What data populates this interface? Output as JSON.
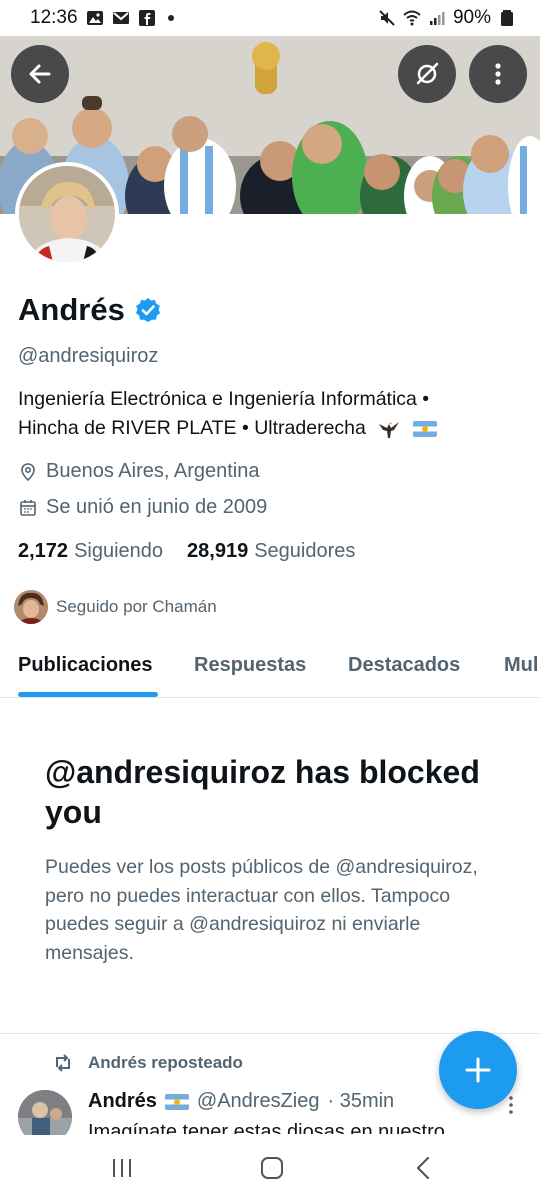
{
  "status_bar": {
    "time": "12:36",
    "battery": "90%",
    "icons": [
      "gallery-icon",
      "gmail-icon",
      "facebook-icon",
      "notification-dot",
      "mute-icon",
      "wifi-icon",
      "signal-icon",
      "battery-icon"
    ]
  },
  "header": {
    "back_icon": "arrow-left-icon",
    "grok_icon": "grok-icon",
    "more_icon": "more-vertical-icon"
  },
  "profile": {
    "name": "Andrés",
    "verified": true,
    "handle": "@andresiquiroz",
    "bio_line1": "Ingeniería Electrónica e Ingeniería Informática •",
    "bio_line2": "Hincha de RIVER PLATE •  Ultraderecha",
    "location": "Buenos Aires, Argentina",
    "joined": "Se unió en junio de 2009",
    "following_count": "2,172",
    "following_label": "Siguiendo",
    "followers_count": "28,919",
    "followers_label": "Seguidores",
    "followed_by": "Seguido por Chamán"
  },
  "tabs": [
    {
      "label": "Publicaciones",
      "active": true
    },
    {
      "label": "Respuestas",
      "active": false
    },
    {
      "label": "Destacados",
      "active": false
    },
    {
      "label": "Mul",
      "active": false
    }
  ],
  "blocked": {
    "title": "@andresiquiroz has blocked you",
    "text": "Puedes ver los posts públicos de @andresiquiroz, pero no puedes interactuar con ellos. Tampoco puedes seguir a @andresiquiroz ni enviarle mensajes."
  },
  "repost_preview": {
    "repost_label": "Andrés reposteado",
    "author_name": "Andrés",
    "author_handle": "@AndresZieg",
    "time": "· 35min",
    "text": "Imagínate tener estas diosas en nuestro"
  },
  "colors": {
    "accent": "#1d9bf0",
    "text_primary": "#0f1419",
    "text_secondary": "#536471"
  }
}
